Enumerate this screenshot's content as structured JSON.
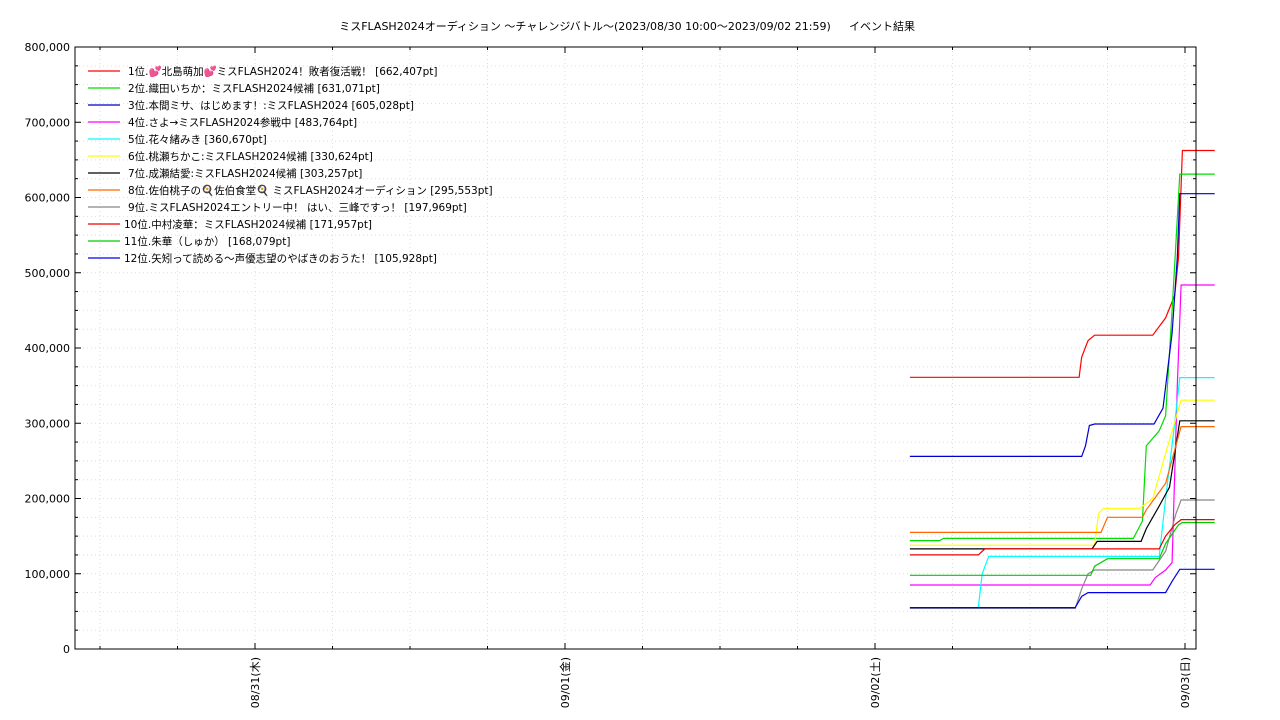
{
  "chart_data": {
    "type": "line",
    "title": "ミスFLASH2024オーディション 〜チャレンジバトル〜(2023/08/30 10:00〜2023/09/02 21:59)",
    "subtitle": "イベント結果",
    "xlabel": "",
    "ylabel": "",
    "ylim": [
      0,
      800000
    ],
    "x_ticks": [
      "08/31(木)",
      "09/01(金)",
      "09/02(土)",
      "09/03(日)"
    ],
    "y_ticks": [
      "0",
      "100,000",
      "200,000",
      "300,000",
      "400,000",
      "500,000",
      "600,000",
      "700,000",
      "800,000"
    ],
    "grid": true,
    "legend_position": "top-left",
    "x_unit": "hours since 08/31 00:00",
    "series": [
      {
        "name": "1位.💕北島萌加💕ミスFLASH2024！敗者復活戦！ [662,407pt]",
        "color": "#ff0000",
        "points": [
          [
            50.7,
            361000
          ],
          [
            63.8,
            361000
          ],
          [
            64.0,
            388000
          ],
          [
            64.5,
            410000
          ],
          [
            65.0,
            417000
          ],
          [
            69.5,
            417000
          ],
          [
            70.5,
            440000
          ],
          [
            71.2,
            470000
          ],
          [
            71.5,
            520000
          ],
          [
            71.8,
            662407
          ],
          [
            72.2,
            662407
          ],
          [
            74.3,
            662407
          ]
        ]
      },
      {
        "name": "2位.織田いちか：ミスFLASH2024候補 [631,071pt]",
        "color": "#00dd00",
        "points": [
          [
            50.7,
            144000
          ],
          [
            53.0,
            144000
          ],
          [
            53.3,
            147000
          ],
          [
            68.0,
            147000
          ],
          [
            68.7,
            170000
          ],
          [
            69.0,
            270000
          ],
          [
            70.0,
            290000
          ],
          [
            70.5,
            310000
          ],
          [
            71.0,
            450000
          ],
          [
            71.6,
            631071
          ],
          [
            74.3,
            631071
          ]
        ]
      },
      {
        "name": "3位.本間ミサ、はじめます！:ミスFLASH2024 [605,028pt]",
        "color": "#0000cc",
        "points": [
          [
            50.7,
            256000
          ],
          [
            64.0,
            256000
          ],
          [
            64.3,
            270000
          ],
          [
            64.6,
            297000
          ],
          [
            65.0,
            299000
          ],
          [
            69.6,
            299000
          ],
          [
            70.3,
            320000
          ],
          [
            71.0,
            420000
          ],
          [
            71.4,
            520000
          ],
          [
            71.6,
            605028
          ],
          [
            74.3,
            605028
          ]
        ]
      },
      {
        "name": "4位.さよ→ミスFLASH2024参戦中 [483,764pt]",
        "color": "#ff00ff",
        "points": [
          [
            50.7,
            85000
          ],
          [
            69.3,
            85000
          ],
          [
            69.7,
            95000
          ],
          [
            70.5,
            105000
          ],
          [
            71.0,
            115000
          ],
          [
            71.4,
            350000
          ],
          [
            71.7,
            483764
          ],
          [
            74.3,
            483764
          ]
        ]
      },
      {
        "name": "5位.花々緒みき [360,670pt]",
        "color": "#00ffff",
        "points": [
          [
            50.7,
            55000
          ],
          [
            56.0,
            55000
          ],
          [
            56.3,
            100000
          ],
          [
            56.8,
            123000
          ],
          [
            70.0,
            123000
          ],
          [
            70.5,
            200000
          ],
          [
            71.2,
            300000
          ],
          [
            71.6,
            360670
          ],
          [
            74.3,
            360670
          ]
        ]
      },
      {
        "name": "6位.桃瀬ちかこ:ミスFLASH2024候補 [330,624pt]",
        "color": "#ffff00",
        "points": [
          [
            50.7,
            138000
          ],
          [
            65.0,
            138000
          ],
          [
            65.3,
            180000
          ],
          [
            65.7,
            187000
          ],
          [
            68.5,
            187000
          ],
          [
            69.5,
            200000
          ],
          [
            70.5,
            260000
          ],
          [
            71.7,
            330624
          ],
          [
            74.3,
            330624
          ]
        ]
      },
      {
        "name": "7位.成瀬結愛:ミスFLASH2024候補 [303,257pt]",
        "color": "#000000",
        "points": [
          [
            50.7,
            133000
          ],
          [
            64.8,
            133000
          ],
          [
            65.2,
            143000
          ],
          [
            68.6,
            143000
          ],
          [
            69.0,
            160000
          ],
          [
            70.0,
            190000
          ],
          [
            70.8,
            215000
          ],
          [
            71.6,
            303257
          ],
          [
            74.3,
            303257
          ]
        ]
      },
      {
        "name": "8位.佐伯桃子の🍳佐伯食堂🍳 ミスFLASH2024オーディション [295,553pt]",
        "color": "#ff6600",
        "points": [
          [
            50.7,
            155000
          ],
          [
            65.5,
            155000
          ],
          [
            66.0,
            175000
          ],
          [
            68.7,
            175000
          ],
          [
            69.0,
            185000
          ],
          [
            70.5,
            220000
          ],
          [
            71.7,
            295553
          ],
          [
            74.3,
            295553
          ]
        ]
      },
      {
        "name": "9位.ミスFLASH2024エントリー中！ はい、三峰ですっ！ [197,969pt]",
        "color": "#888888",
        "points": [
          [
            50.7,
            54000
          ],
          [
            63.5,
            54000
          ],
          [
            64.0,
            80000
          ],
          [
            64.5,
            100000
          ],
          [
            65.0,
            105000
          ],
          [
            69.5,
            105000
          ],
          [
            70.5,
            130000
          ],
          [
            71.3,
            180000
          ],
          [
            71.7,
            197969
          ],
          [
            74.3,
            197969
          ]
        ]
      },
      {
        "name": "10位.中村凌華：ミスFLASH2024候補 [171,957pt]",
        "color": "#ee0000",
        "points": [
          [
            50.7,
            125000
          ],
          [
            56.0,
            125000
          ],
          [
            56.5,
            133000
          ],
          [
            70.0,
            133000
          ],
          [
            70.5,
            150000
          ],
          [
            71.2,
            165000
          ],
          [
            71.7,
            171957
          ],
          [
            74.3,
            171957
          ]
        ]
      },
      {
        "name": "11位.朱華（しゅか） [168,079pt]",
        "color": "#00cc00",
        "points": [
          [
            50.7,
            98000
          ],
          [
            64.7,
            98000
          ],
          [
            65.0,
            110000
          ],
          [
            66.0,
            120000
          ],
          [
            70.0,
            120000
          ],
          [
            70.5,
            140000
          ],
          [
            71.5,
            165000
          ],
          [
            71.8,
            168079
          ],
          [
            74.3,
            168079
          ]
        ]
      },
      {
        "name": "12位.矢矧って読める〜声優志望のやばきのおうた！ [105,928pt]",
        "color": "#0000ee",
        "points": [
          [
            50.7,
            55000
          ],
          [
            63.5,
            55000
          ],
          [
            64.0,
            70000
          ],
          [
            64.5,
            75000
          ],
          [
            70.5,
            75000
          ],
          [
            71.0,
            90000
          ],
          [
            71.6,
            105928
          ],
          [
            74.3,
            105928
          ]
        ]
      }
    ]
  }
}
